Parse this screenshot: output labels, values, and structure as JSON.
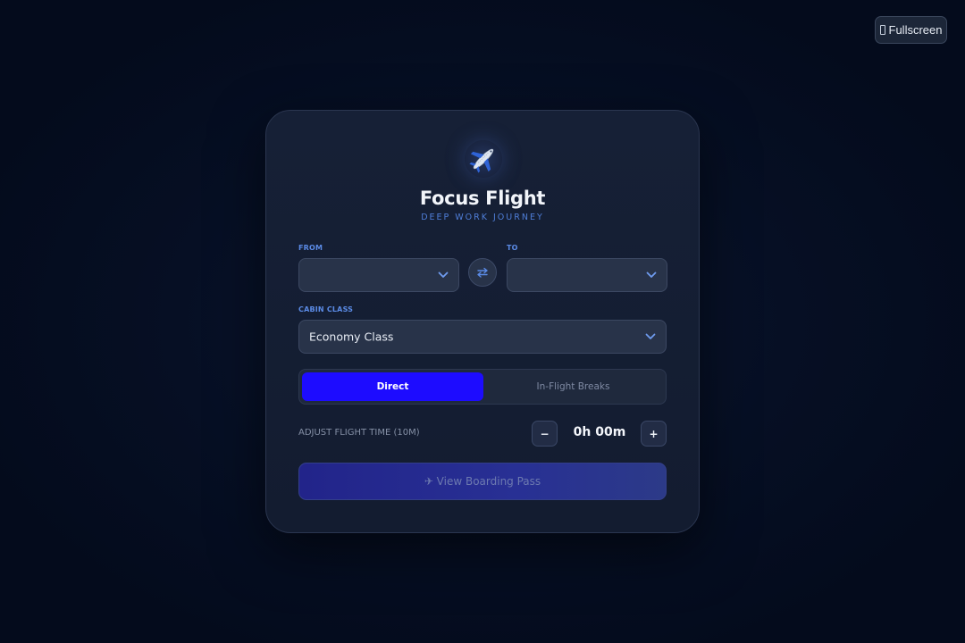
{
  "fullscreen": {
    "label": "Fullscreen"
  },
  "app": {
    "title": "Focus Flight",
    "subtitle": "DEEP WORK JOURNEY"
  },
  "route": {
    "from_label": "FROM",
    "from_value": "",
    "to_label": "TO",
    "to_value": ""
  },
  "cabin": {
    "label": "CABIN CLASS",
    "value": "Economy Class"
  },
  "mode": {
    "options": [
      "Direct",
      "In-Flight Breaks"
    ],
    "selected": "Direct"
  },
  "flight_time": {
    "label": "ADJUST FLIGHT TIME (10M)",
    "decrement": "−",
    "increment": "+",
    "value": "0h 00m"
  },
  "cta": {
    "label": "✈ View Boarding Pass"
  },
  "colors": {
    "accent": "#1d0cff",
    "label_blue": "#5b8be6",
    "background": "#040b1c",
    "card": "#162036"
  }
}
